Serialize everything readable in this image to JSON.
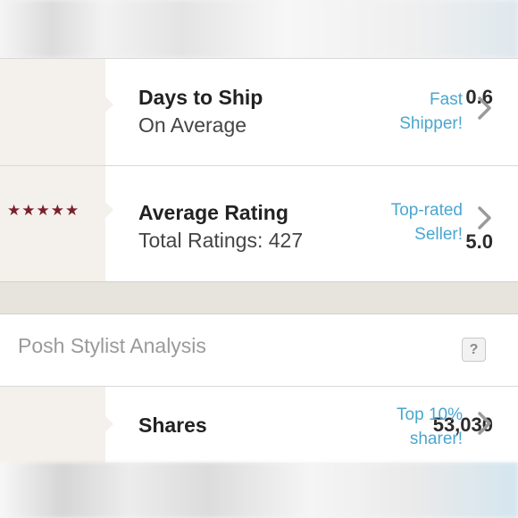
{
  "rows": [
    {
      "left_value": "0.6",
      "title": "Days to Ship",
      "subtitle": "On Average",
      "badge_line1": "Fast",
      "badge_line2": "Shipper!"
    },
    {
      "stars": "★★★★★",
      "left_value": "5.0",
      "title": "Average Rating",
      "subtitle": "Total Ratings: 427",
      "badge_line1": "Top-rated",
      "badge_line2": "Seller!"
    },
    {
      "left_value": "53,030",
      "title": "Shares",
      "badge_line1": "Top 10%",
      "badge_line2": "sharer!"
    }
  ],
  "section": {
    "title": "Posh Stylist Analysis",
    "help_label": "?"
  },
  "colors": {
    "accent_link": "#4aa6cf",
    "star": "#7a1f2b",
    "left_panel": "#f4f1ec"
  },
  "rating_value": 5.0,
  "rating_max": 5
}
